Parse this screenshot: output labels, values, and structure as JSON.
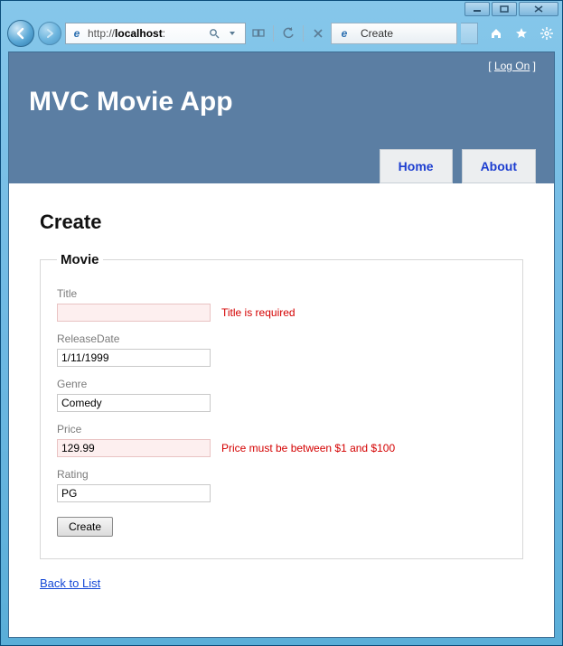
{
  "window": {
    "url_prefix": "http://",
    "url_host": "localhost",
    "url_rest": ":",
    "tab_title": "Create"
  },
  "header": {
    "logon_left": "[ ",
    "logon_link": "Log On",
    "logon_right": " ]",
    "title": "MVC Movie App",
    "menu": {
      "home": "Home",
      "about": "About"
    }
  },
  "page": {
    "heading": "Create",
    "legend": "Movie",
    "back_link": "Back to List"
  },
  "form": {
    "title": {
      "label": "Title",
      "value": "",
      "error": "Title is required"
    },
    "releaseDate": {
      "label": "ReleaseDate",
      "value": "1/11/1999"
    },
    "genre": {
      "label": "Genre",
      "value": "Comedy"
    },
    "price": {
      "label": "Price",
      "value": "129.99",
      "error": "Price must be between $1 and $100"
    },
    "rating": {
      "label": "Rating",
      "value": "PG"
    },
    "submit": "Create"
  }
}
